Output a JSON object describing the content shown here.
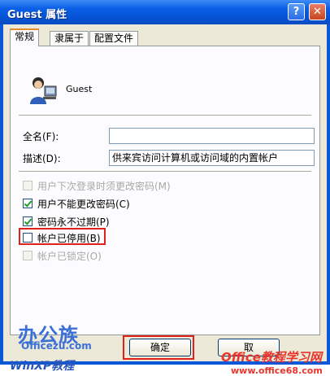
{
  "window": {
    "title": "Guest 属性",
    "help_label": "?",
    "close_label": "✕"
  },
  "tabs": [
    "常规",
    "隶属于",
    "配置文件"
  ],
  "user": {
    "name": "Guest"
  },
  "form": {
    "fullname_label": "全名(F):",
    "fullname_value": "",
    "desc_label": "描述(D):",
    "desc_value": "供来宾访问计算机或访问域的内置帐户"
  },
  "checkboxes": [
    {
      "label": "用户下次登录时须更改密码(M)",
      "checked": false,
      "enabled": false
    },
    {
      "label": "用户不能更改密码(C)",
      "checked": true,
      "enabled": true
    },
    {
      "label": "密码永不过期(P)",
      "checked": true,
      "enabled": true
    },
    {
      "label": "帐户已停用(B)",
      "checked": false,
      "enabled": true
    },
    {
      "label": "帐户已锁定(O)",
      "checked": false,
      "enabled": false
    }
  ],
  "buttons": {
    "ok": "确定",
    "cancel": "取"
  },
  "watermark": {
    "logo_main": "办公族",
    "logo_url": "Officezu.com",
    "logo_sub": "WinXP教程",
    "site_name": "Office教程学习网",
    "site_url": "www.office68.com"
  },
  "colors": {
    "titlebar": "#0553d6",
    "highlight": "#e0201a"
  }
}
